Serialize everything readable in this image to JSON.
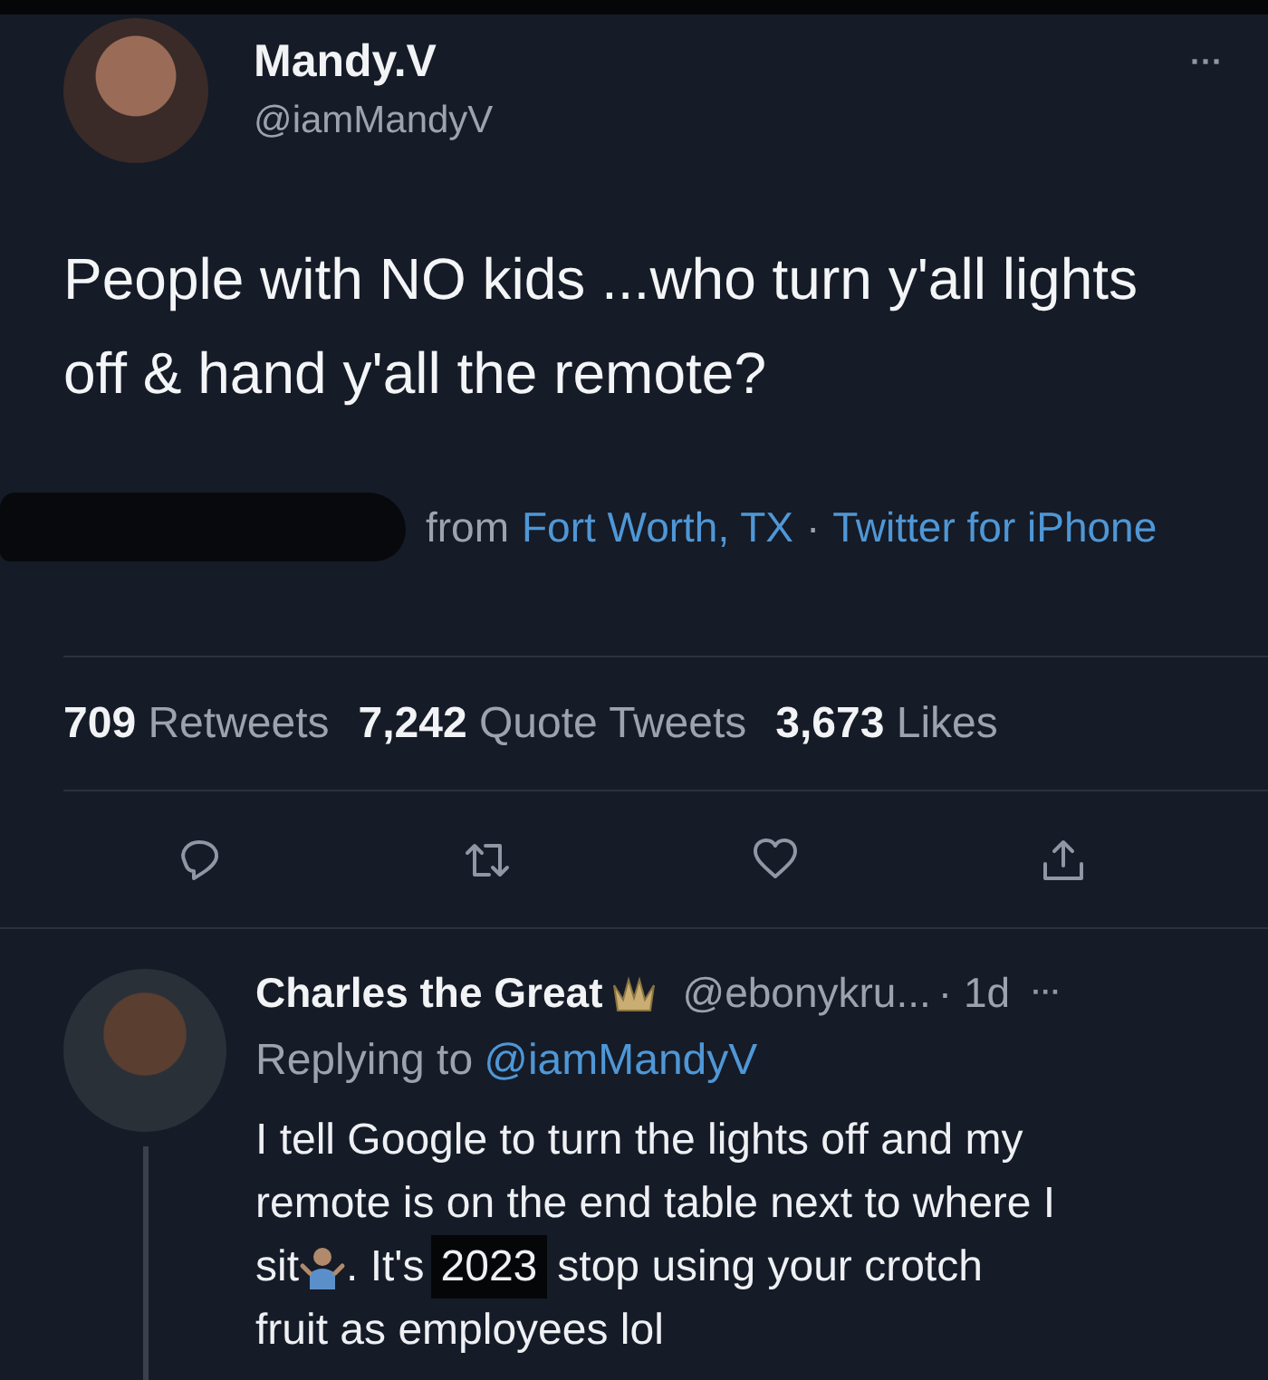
{
  "tweet": {
    "display_name": "Mandy.V",
    "handle": "@iamMandyV",
    "more": "···",
    "text": "People with NO kids ...who turn y'all lights off & hand y'all the remote?",
    "meta": [
      {
        "kind": "plain",
        "text": "from"
      },
      {
        "kind": "link",
        "text": "Fort Worth, TX"
      },
      {
        "kind": "plain",
        "text": "·"
      },
      {
        "kind": "link",
        "text": "Twitter for iPhone"
      }
    ],
    "stats": [
      "**709** Retweets",
      "**7,242** Quote Tweets",
      "**3,673** Likes"
    ],
    "actions": [
      {
        "kind": "reply"
      },
      {
        "kind": "retweet"
      },
      {
        "kind": "like"
      },
      {
        "kind": "share"
      }
    ]
  },
  "reply": {
    "display_name": "Charles the Great",
    "handle": "@ebonykru...",
    "time": "· 1d",
    "more": "···",
    "replying_label": "Replying to",
    "replying_handle": "@iamMandyV",
    "body": [
      [
        {
          "kind": "text",
          "text": "I tell Google to turn the lights off and my"
        }
      ],
      [
        {
          "kind": "text",
          "text": "remote is on the end table next to where I"
        }
      ],
      [
        {
          "kind": "text",
          "text": "sit"
        },
        {
          "kind": "emoji"
        },
        {
          "kind": "text",
          "text": ". It's"
        },
        {
          "kind": "highlight",
          "text": "2023"
        },
        {
          "kind": "text",
          "text": "stop using your crotch"
        }
      ],
      [
        {
          "kind": "text",
          "text": "fruit as employees lol"
        }
      ]
    ]
  }
}
